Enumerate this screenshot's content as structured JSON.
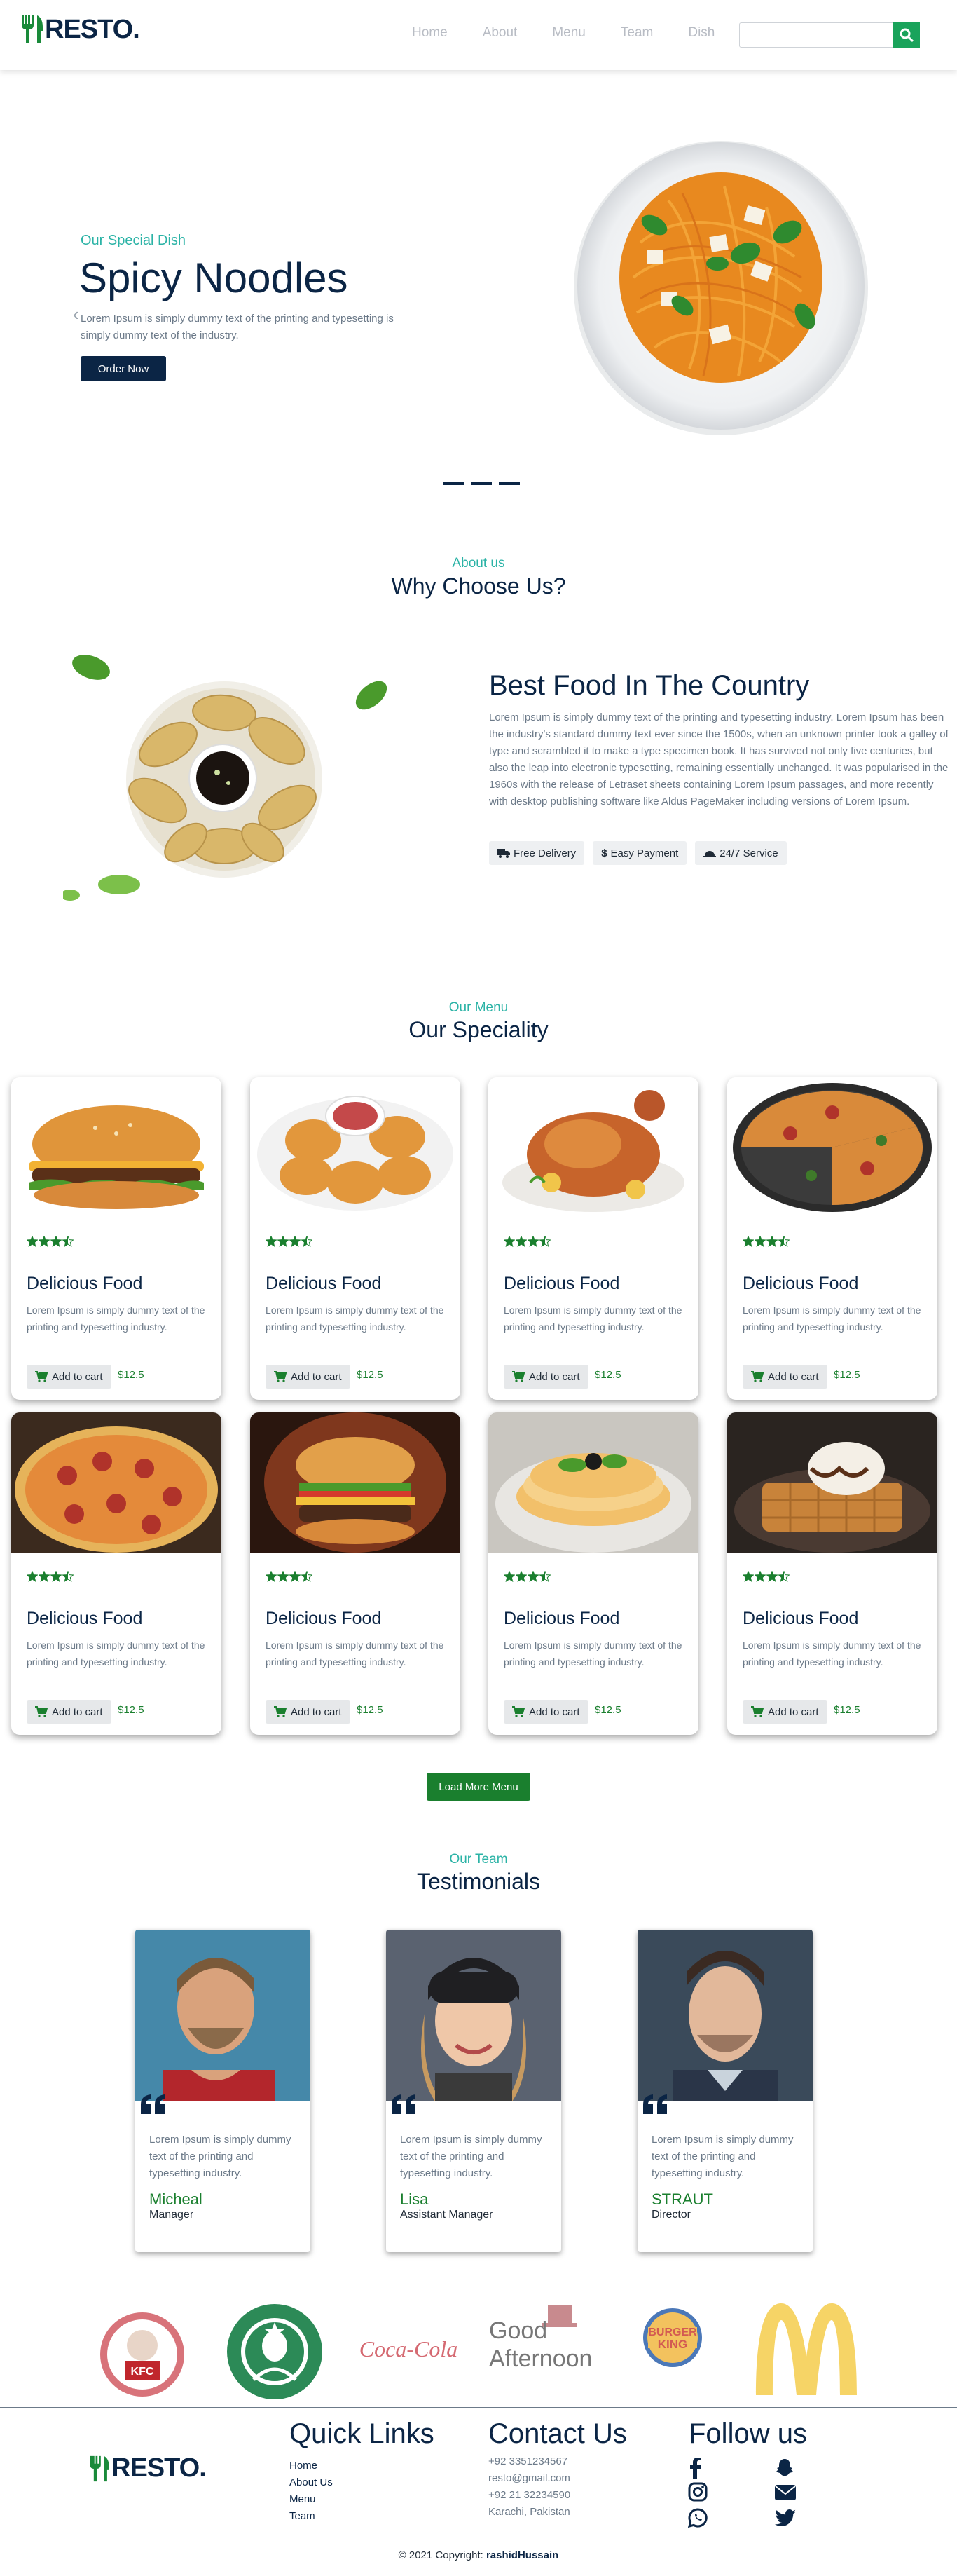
{
  "brand": {
    "name": "RESTO."
  },
  "nav": {
    "items": [
      "Home",
      "About",
      "Menu",
      "Team",
      "Dish"
    ],
    "search_placeholder": ""
  },
  "hero": {
    "subtitle": "Our Special Dish",
    "title": "Spicy Noodles",
    "text": "Lorem Ipsum is simply dummy text of the printing and typesetting is simply dummy text of the industry.",
    "button": "Order Now"
  },
  "about": {
    "subtitle": "About us",
    "title": "Why Choose Us?",
    "heading": "Best Food In The Country",
    "text": "Lorem Ipsum is simply dummy text of the printing and typesetting industry. Lorem Ipsum has been the industry's standard dummy text ever since the 1500s, when an unknown printer took a galley of type and scrambled it to make a type specimen book. It has survived not only five centuries, but also the leap into electronic typesetting, remaining essentially unchanged. It was popularised in the 1960s with the release of Letraset sheets containing Lorem Ipsum passages, and more recently with desktop publishing software like Aldus PageMaker including versions of Lorem Ipsum.",
    "features": [
      "Free Delivery",
      "Easy Payment",
      "24/7 Service"
    ]
  },
  "menu": {
    "subtitle": "Our Menu",
    "title": "Our Speciality",
    "rating": 3.5,
    "items": [
      {
        "title": "Delicious Food",
        "text": "Lorem Ipsum is simply dummy text of the printing and typesetting industry.",
        "cart": "Add to cart",
        "price": "$12.5"
      },
      {
        "title": "Delicious Food",
        "text": "Lorem Ipsum is simply dummy text of the printing and typesetting industry.",
        "cart": "Add to cart",
        "price": "$12.5"
      },
      {
        "title": "Delicious Food",
        "text": "Lorem Ipsum is simply dummy text of the printing and typesetting industry.",
        "cart": "Add to cart",
        "price": "$12.5"
      },
      {
        "title": "Delicious Food",
        "text": "Lorem Ipsum is simply dummy text of the printing and typesetting industry.",
        "cart": "Add to cart",
        "price": "$12.5"
      },
      {
        "title": "Delicious Food",
        "text": "Lorem Ipsum is simply dummy text of the printing and typesetting industry.",
        "cart": "Add to cart",
        "price": "$12.5"
      },
      {
        "title": "Delicious Food",
        "text": "Lorem Ipsum is simply dummy text of the printing and typesetting industry.",
        "cart": "Add to cart",
        "price": "$12.5"
      },
      {
        "title": "Delicious Food",
        "text": "Lorem Ipsum is simply dummy text of the printing and typesetting industry.",
        "cart": "Add to cart",
        "price": "$12.5"
      },
      {
        "title": "Delicious Food",
        "text": "Lorem Ipsum is simply dummy text of the printing and typesetting industry.",
        "cart": "Add to cart",
        "price": "$12.5"
      }
    ],
    "load_more": "Load More Menu"
  },
  "team": {
    "subtitle": "Our Team",
    "title": "Testimonials",
    "members": [
      {
        "quote": "Lorem Ipsum is simply dummy text of the printing and typesetting industry.",
        "name": "Micheal",
        "role": "Manager"
      },
      {
        "quote": "Lorem Ipsum is simply dummy text of the printing and typesetting industry.",
        "name": "Lisa",
        "role": "Assistant Manager"
      },
      {
        "quote": "Lorem Ipsum is simply dummy text of the printing and typesetting industry.",
        "name": "STRAUT",
        "role": "Director"
      }
    ]
  },
  "brands": {
    "kfc": "KFC",
    "cocacola": "Coca-Cola",
    "goodafternoon_1": "Good",
    "goodafternoon_2": "Afternoon",
    "burgerking_1": "BURGER",
    "burgerking_2": "KING"
  },
  "footer": {
    "quick_links_title": "Quick Links",
    "quick_links": [
      "Home",
      "About Us",
      "Menu",
      "Team"
    ],
    "contact_title": "Contact Us",
    "contact": [
      "+92 3351234567",
      "resto@gmail.com",
      "+92 21 32234590",
      "Karachi, Pakistan"
    ],
    "follow_title": "Follow us",
    "copyright": "© 2021 Copyright:",
    "author": "rashidHussain"
  },
  "colors": {
    "primary": "#0b2545",
    "teal": "#2bb3a6",
    "green": "#1a7f2e",
    "gray": "#6c7a89"
  }
}
